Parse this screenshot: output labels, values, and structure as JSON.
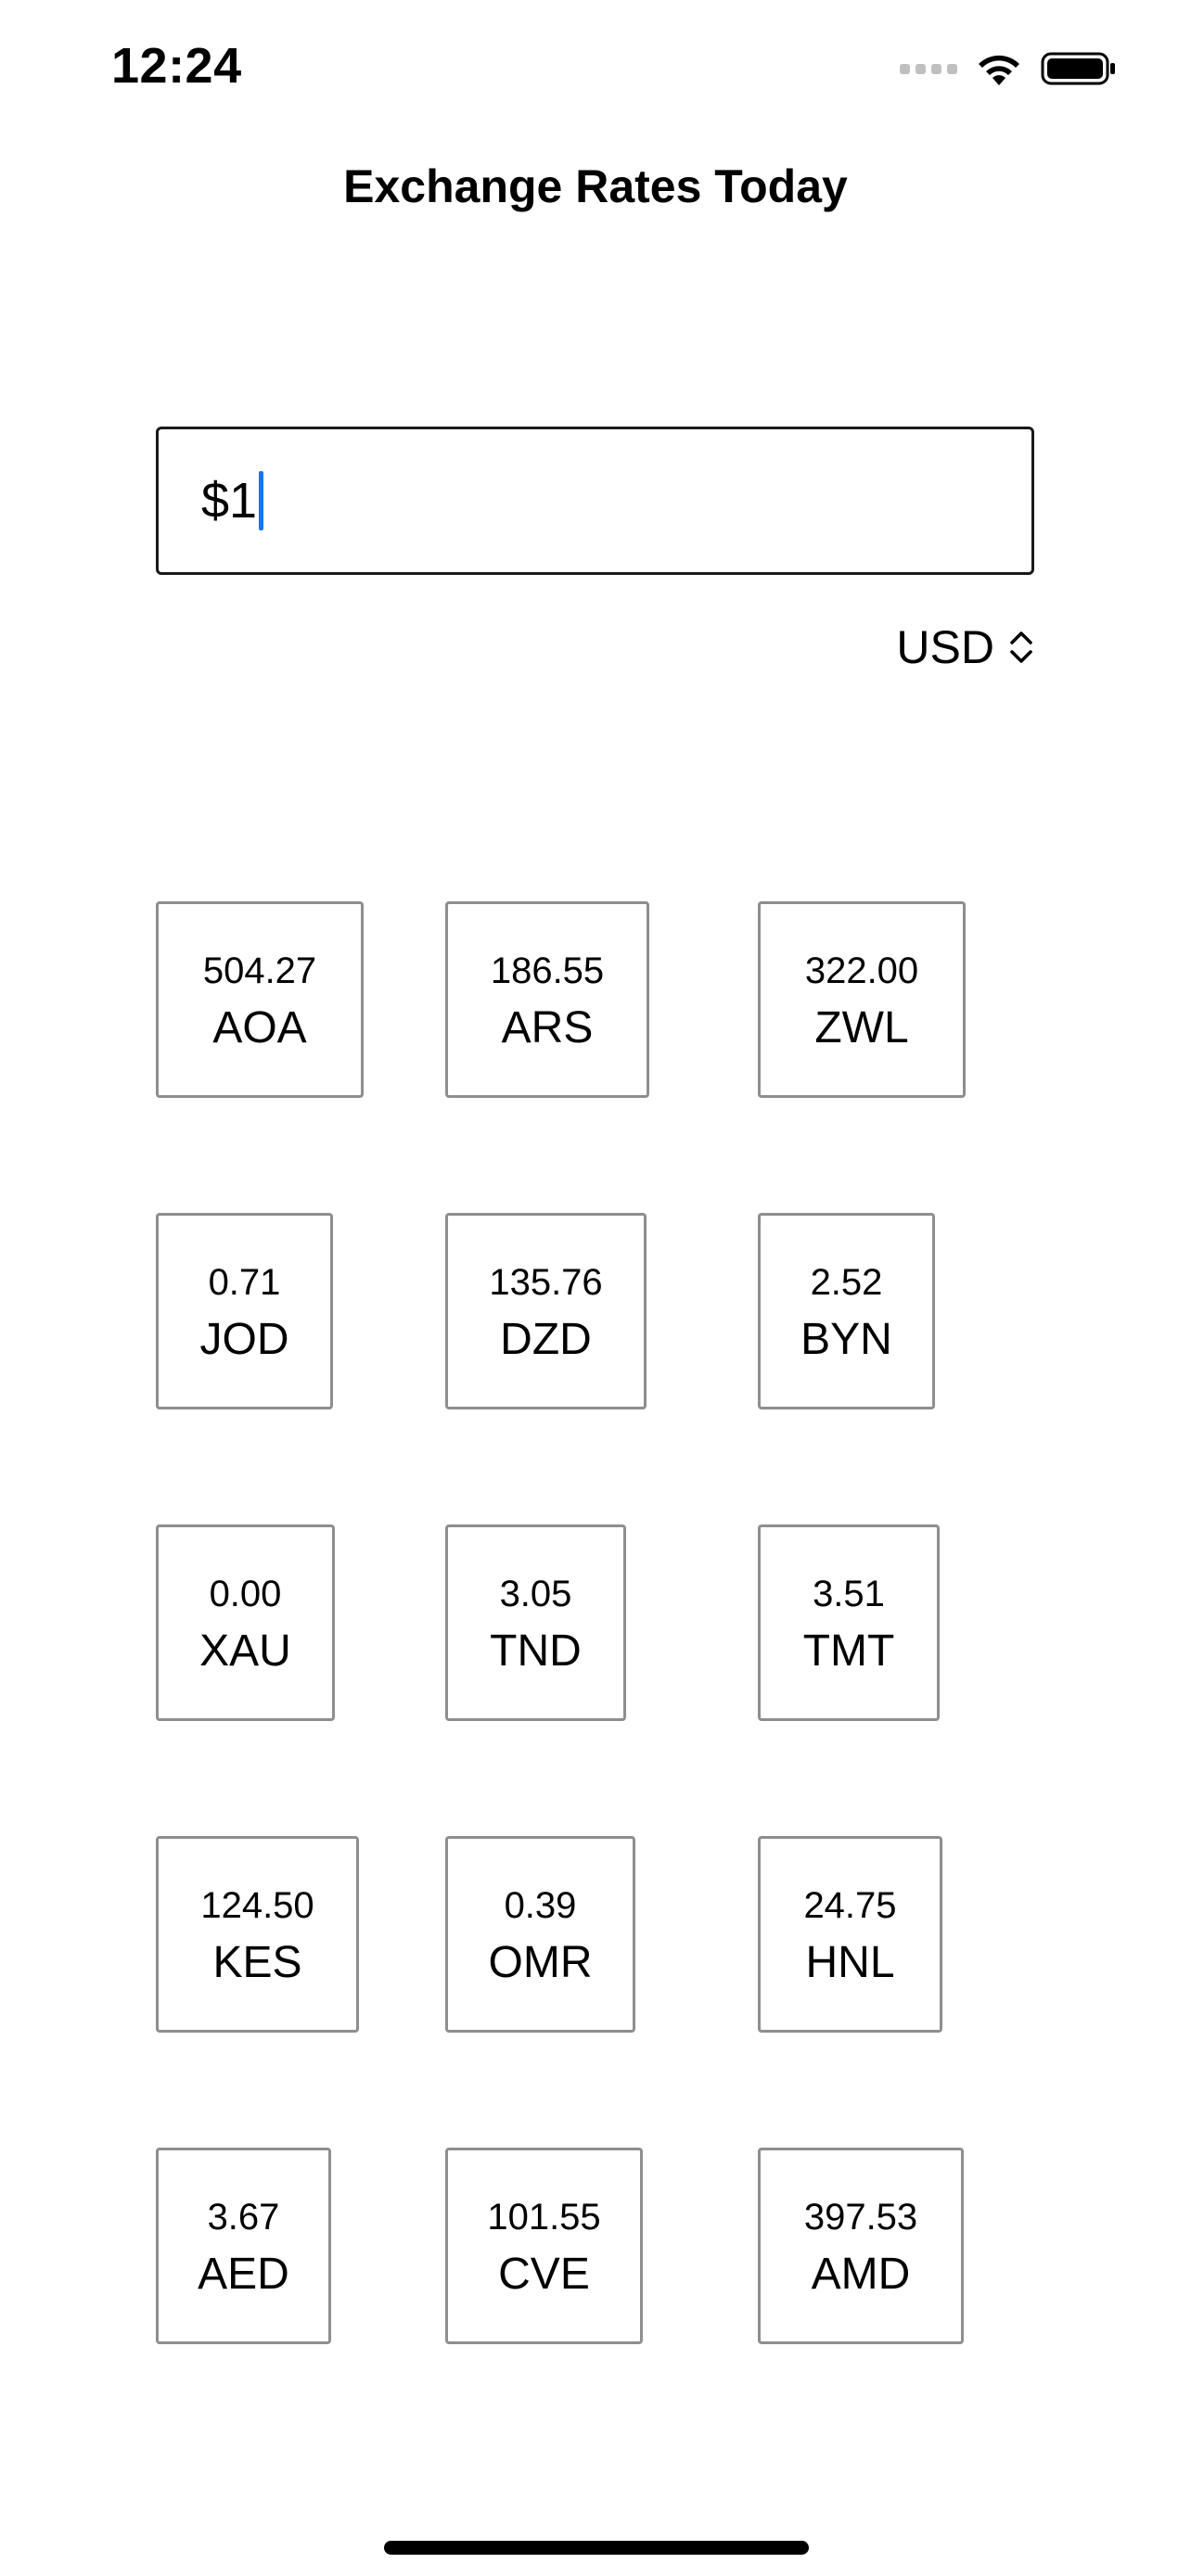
{
  "status_bar": {
    "time": "12:24"
  },
  "header": {
    "title": "Exchange Rates Today"
  },
  "amount_input": {
    "value": "$1"
  },
  "currency_picker": {
    "selected": "USD"
  },
  "rates": [
    {
      "rate": "504.27",
      "code": "AOA"
    },
    {
      "rate": "186.55",
      "code": "ARS"
    },
    {
      "rate": "322.00",
      "code": "ZWL"
    },
    {
      "rate": "0.71",
      "code": "JOD"
    },
    {
      "rate": "135.76",
      "code": "DZD"
    },
    {
      "rate": "2.52",
      "code": "BYN"
    },
    {
      "rate": "0.00",
      "code": "XAU"
    },
    {
      "rate": "3.05",
      "code": "TND"
    },
    {
      "rate": "3.51",
      "code": "TMT"
    },
    {
      "rate": "124.50",
      "code": "KES"
    },
    {
      "rate": "0.39",
      "code": "OMR"
    },
    {
      "rate": "24.75",
      "code": "HNL"
    },
    {
      "rate": "3.67",
      "code": "AED"
    },
    {
      "rate": "101.55",
      "code": "CVE"
    },
    {
      "rate": "397.53",
      "code": "AMD"
    }
  ]
}
